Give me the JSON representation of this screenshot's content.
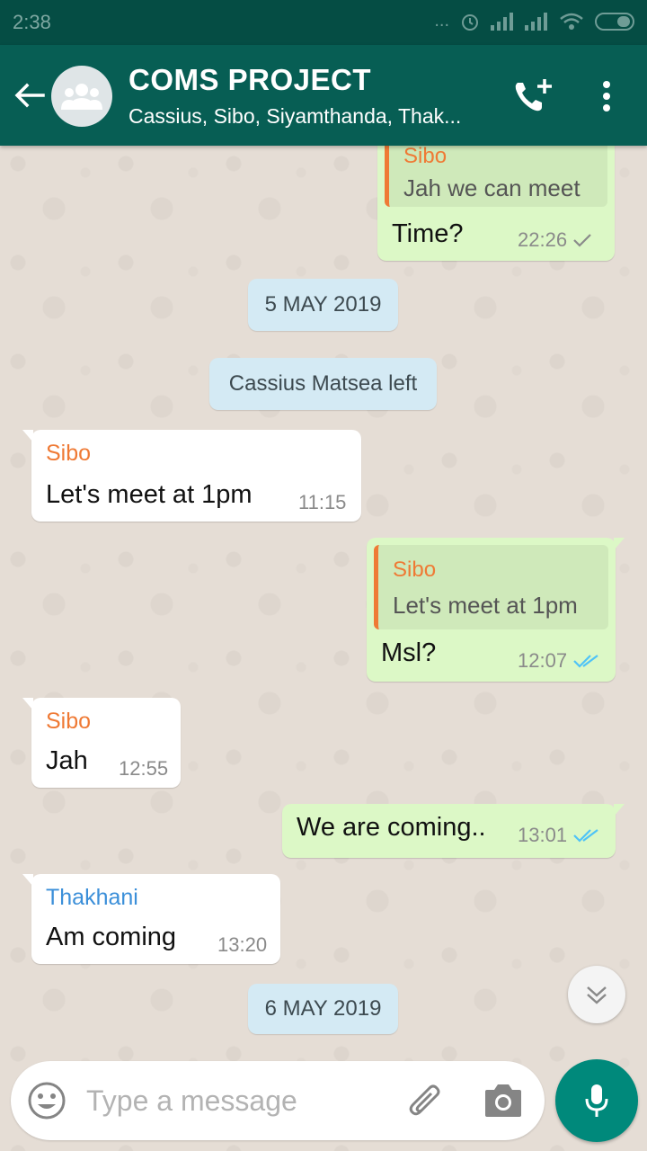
{
  "status_bar": {
    "time": "2:38",
    "dots": "..."
  },
  "header": {
    "title": "COMS PROJECT",
    "subtitle": "Cassius, Sibo, Siyamthanda, Thak..."
  },
  "messages": [
    {
      "type": "out",
      "quote_sender": "Sibo",
      "quote_text": "Jah we can meet",
      "text": "Time?",
      "time": "22:26",
      "status": "sent"
    },
    {
      "type": "date",
      "text": "5 MAY 2019"
    },
    {
      "type": "system",
      "text": "Cassius Matsea left"
    },
    {
      "type": "in",
      "sender": "Sibo",
      "text": "Let's meet at 1pm",
      "time": "11:15"
    },
    {
      "type": "out",
      "quote_sender": "Sibo",
      "quote_text": "Let's meet at 1pm",
      "text": "Msl?",
      "time": "12:07",
      "status": "read"
    },
    {
      "type": "in",
      "sender": "Sibo",
      "text": "Jah",
      "time": "12:55"
    },
    {
      "type": "out",
      "text": "We are coming..",
      "time": "13:01",
      "status": "read"
    },
    {
      "type": "in",
      "sender": "Thakhani",
      "text": "Am coming",
      "time": "13:20"
    },
    {
      "type": "date",
      "text": "6 MAY 2019"
    }
  ],
  "colors": {
    "header": "#075e54",
    "outgoing_bubble": "#dcf8c6",
    "sibo": "#ef7a35",
    "thakhani": "#3b8fd9",
    "read_tick": "#4fc3f7",
    "mic_button": "#00897b"
  },
  "input": {
    "placeholder": "Type a message",
    "value": ""
  },
  "icons": [
    "back-arrow-icon",
    "group-avatar-icon",
    "add-call-icon",
    "more-vertical-icon",
    "scroll-down-icon",
    "emoji-icon",
    "attach-icon",
    "camera-icon",
    "mic-icon"
  ]
}
